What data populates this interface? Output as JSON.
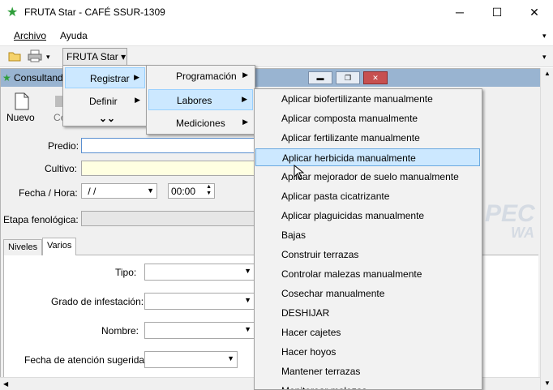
{
  "window": {
    "title": "FRUTA Star - CAFÉ SSUR-1309",
    "minimize_glyph": "─",
    "maximize_glyph": "☐",
    "close_glyph": "✕"
  },
  "menubar": {
    "items": [
      "Archivo",
      "Ayuda"
    ],
    "right_arrow": "▾"
  },
  "toolbar": {
    "fruta_button": "FRUTA Star ▾",
    "print_dropdown": "▾",
    "right_arrow": "▾"
  },
  "child_window": {
    "title": "Consultand",
    "nuevo": "Nuevo",
    "second_btn_fragment": "Ce"
  },
  "form": {
    "predio_label": "Predio:",
    "cultivo_label": "Cultivo:",
    "fecha_label": "Fecha / Hora:",
    "fecha_value": " / /",
    "hora_value": "00:00",
    "etapa_label": "Etapa fenológica:",
    "tabs": [
      "Niveles",
      "Varios"
    ],
    "tipo_label": "Tipo:",
    "grado_label": "Grado de infestación:",
    "nombre_label": "Nombre:",
    "fecha_atencion_label": "Fecha de atención sugerida:"
  },
  "menu_level1": {
    "items": [
      "Registrar",
      "Definir"
    ],
    "more_glyph": "⌄⌄"
  },
  "menu_level2": {
    "items": [
      "Programación",
      "Labores",
      "Mediciones"
    ]
  },
  "menu_level3": {
    "items": [
      "Aplicar biofertilizante manualmente",
      "Aplicar composta manualmente",
      "Aplicar fertilizante manualmente",
      "Aplicar herbicida manualmente",
      "Aplicar mejorador de suelo manualmente",
      "Aplicar pasta cicatrizante",
      "Aplicar plaguicidas manualmente",
      "Bajas",
      "Construir terrazas",
      "Controlar malezas manualmente",
      "Cosechar manualmente",
      "DESHIJAR",
      "Hacer cajetes",
      "Hacer hoyos",
      "Mantener terrazas",
      "Monitorear malezas"
    ],
    "highlighted_index": 3
  },
  "watermark": {
    "line1": "PEC S",
    "line2": "WA"
  },
  "colors": {
    "highlight": "#cce8ff",
    "child_titlebar": "#99b4d1",
    "app_icon": "#2e9e3a"
  },
  "icons": [
    "star-icon",
    "folder-icon",
    "printer-icon",
    "new-document-icon",
    "submenu-arrow-icon",
    "chevron-down-icon"
  ]
}
